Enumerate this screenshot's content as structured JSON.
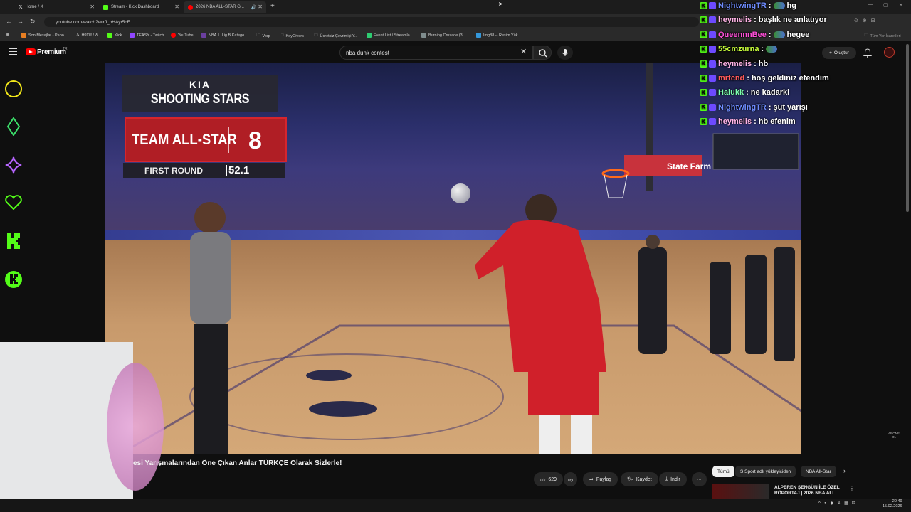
{
  "browser": {
    "tabs": [
      {
        "title": "Home / X",
        "favicon_color": "#ffffff"
      },
      {
        "title": "Stream - Kick Dashboard",
        "favicon_color": "#53fc18"
      },
      {
        "title": "2026 NBA ALL-STAR G...",
        "favicon_color": "#ff0000"
      }
    ],
    "url": "youtube.com/watch?v=rJ_bHAyr5cE",
    "bookmarks": [
      "Son Mesajlar - Pabo...",
      "Home / X",
      "Kick",
      "TEASY - Twitch",
      "YouTube",
      "NBA 1. Lig B Katego...",
      "Vorp",
      "KeyGivers",
      "Ücretsiz Çevrimiçi Y...",
      "Event List / Streamla...",
      "Burning Crusade (3...",
      "Img88 -- Resim Yük..."
    ],
    "bookmarks_right": "Tüm Yer İşaretleri"
  },
  "youtube": {
    "brand": "Premium",
    "region": "TR",
    "search_query": "nba dunk contest",
    "create_label": "Oluştur",
    "video_title": "esi Yarışmalarından Öne Çıkan Anlar TÜRKÇE Olarak Sizlerle!",
    "like_count": "629",
    "share_label": "Paylaş",
    "save_label": "Kaydet",
    "download_label": "İndir",
    "chips": [
      "Tümü",
      "S Sport adlı yükleyiciden",
      "NBA All-Star"
    ],
    "reco_title": "ALPEREN ŞENGÜN İLE ÖZEL RÖPORTAJ | 2026 NBA ALL..."
  },
  "scoreboard": {
    "sponsor": "KIA",
    "event": "SHOOTING STARS",
    "team": "TEAM ALL-STAR",
    "score": "8",
    "round": "FIRST ROUND",
    "time": "52.1"
  },
  "arena": {
    "sponsor_board": "State Farm"
  },
  "chat": [
    {
      "user": "NightwingTR",
      "color": "#6e8cff",
      "msg": "hg"
    },
    {
      "user": "heymelis",
      "color": "#ffb3e6",
      "msg": "başlık ne anlatıyor"
    },
    {
      "user": "QueennnBee",
      "color": "#ff4fd8",
      "msg": "hegee"
    },
    {
      "user": "55cmzurna",
      "color": "#c8ff3a",
      "msg": ""
    },
    {
      "user": "heymelis",
      "color": "#ffb3e6",
      "msg": "hb"
    },
    {
      "user": "mrtcnd",
      "color": "#ff5a5a",
      "msg": "hoş geldiniz efendim"
    },
    {
      "user": "Halukk",
      "color": "#7dffb0",
      "msg": "ne kadarki"
    },
    {
      "user": "NightwingTR",
      "color": "#6e8cff",
      "msg": "şut yarışı"
    },
    {
      "user": "heymelis",
      "color": "#ffb3e6",
      "msg": "hb efenim"
    }
  ],
  "system": {
    "time": "20:49",
    "date": "15.02.2026"
  },
  "watermark": "ARONE OL",
  "colors": {
    "kick_green": "#53fc18",
    "youtube_red": "#ff0000",
    "team_red": "#b01e25"
  }
}
